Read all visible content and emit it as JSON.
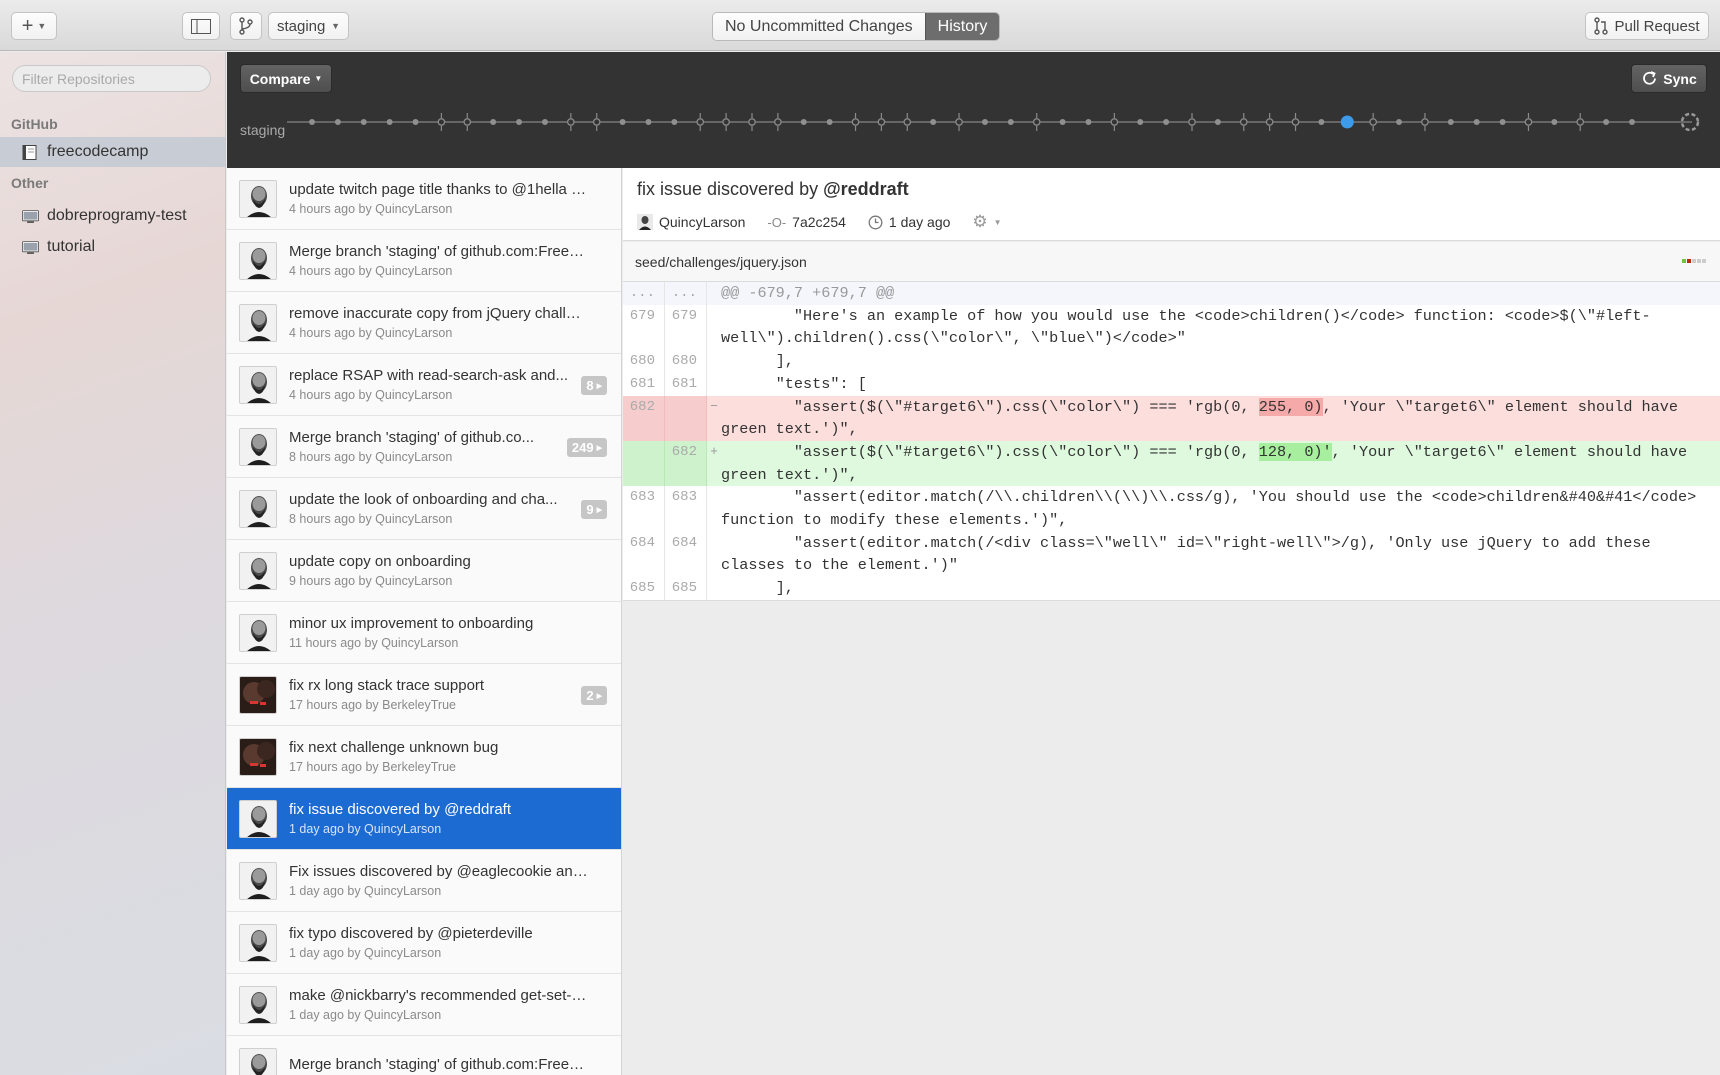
{
  "toolbar": {
    "add_icon": "plus-icon",
    "branch_name": "staging",
    "segments": [
      "No Uncommitted Changes",
      "History"
    ],
    "active_segment": "History",
    "pull_request_label": "Pull Request"
  },
  "sidebar": {
    "filter_placeholder": "Filter Repositories",
    "github_header": "GitHub",
    "github_repos": [
      "freecodecamp"
    ],
    "other_header": "Other",
    "other_repos": [
      "dobreprogramy-test",
      "tutorial"
    ]
  },
  "timeline": {
    "compare_label": "Compare",
    "sync_label": "Sync",
    "branch_label": "staging",
    "accent": "#3d9be9"
  },
  "commits": [
    {
      "title": "update twitch page title thanks to @1hella for...",
      "meta": "4 hours ago by QuincyLarson",
      "author": "QuincyLarson",
      "badge": ""
    },
    {
      "title": "Merge branch 'staging' of github.com:FreeCo...",
      "meta": "4 hours ago by QuincyLarson",
      "author": "QuincyLarson",
      "badge": ""
    },
    {
      "title": "remove inaccurate copy from jQuery challenge",
      "meta": "4 hours ago by QuincyLarson",
      "author": "QuincyLarson",
      "badge": ""
    },
    {
      "title": "replace RSAP with read-search-ask and...",
      "meta": "4 hours ago by QuincyLarson",
      "author": "QuincyLarson",
      "badge": "8"
    },
    {
      "title": "Merge branch 'staging' of github.co...",
      "meta": "8 hours ago by QuincyLarson",
      "author": "QuincyLarson",
      "badge": "249"
    },
    {
      "title": "update the look of onboarding and cha...",
      "meta": "8 hours ago by QuincyLarson",
      "author": "QuincyLarson",
      "badge": "9"
    },
    {
      "title": "update copy on onboarding",
      "meta": "9 hours ago by QuincyLarson",
      "author": "QuincyLarson",
      "badge": ""
    },
    {
      "title": "minor ux improvement to onboarding",
      "meta": "11 hours ago by QuincyLarson",
      "author": "QuincyLarson",
      "badge": ""
    },
    {
      "title": "fix rx long stack trace support",
      "meta": "17 hours ago by BerkeleyTrue",
      "author": "BerkeleyTrue",
      "badge": "2"
    },
    {
      "title": "fix next challenge unknown bug",
      "meta": "17 hours ago by BerkeleyTrue",
      "author": "BerkeleyTrue",
      "badge": ""
    },
    {
      "title": "fix issue discovered by @reddraft",
      "meta": "1 day ago by QuincyLarson",
      "author": "QuincyLarson",
      "badge": "",
      "selected": true
    },
    {
      "title": "Fix issues discovered by @eaglecookie and @...",
      "meta": "1 day ago by QuincyLarson",
      "author": "QuincyLarson",
      "badge": ""
    },
    {
      "title": "fix typo discovered by @pieterdeville",
      "meta": "1 day ago by QuincyLarson",
      "author": "QuincyLarson",
      "badge": ""
    },
    {
      "title": "make @nickbarry's recommended get-set-for...",
      "meta": "1 day ago by QuincyLarson",
      "author": "QuincyLarson",
      "badge": ""
    },
    {
      "title": "Merge branch 'staging' of github.com:FreeCo...",
      "meta": "",
      "author": "QuincyLarson",
      "badge": ""
    }
  ],
  "detail": {
    "title_prefix": "fix issue discovered by ",
    "title_mention": "@reddraft",
    "author": "QuincyLarson",
    "sha": "7a2c254",
    "time": "1 day ago",
    "file": "seed/challenges/jquery.json",
    "diff": [
      {
        "type": "hunk",
        "old": "...",
        "new": "...",
        "mark": "",
        "code": "@@ -679,7 +679,7 @@"
      },
      {
        "type": "ctx",
        "old": "679",
        "new": "679",
        "mark": "",
        "code": "        \"Here's an example of how you would use the <code>children()</code> function: <code>$(\\\"#left-well\\\").children().css(\\\"color\\\", \\\"blue\\\")</code>\""
      },
      {
        "type": "ctx",
        "old": "680",
        "new": "680",
        "mark": "",
        "code": "      ],"
      },
      {
        "type": "ctx",
        "old": "681",
        "new": "681",
        "mark": "",
        "code": "      \"tests\": ["
      },
      {
        "type": "del",
        "old": "682",
        "new": "",
        "mark": "−",
        "pre": "        \"assert($(\\\"#target6\\\").css(\\\"color\\\") === 'rgb(0, ",
        "hl": "255, 0)",
        "post": ", 'Your \\\"target6\\\" element should have green text.')\","
      },
      {
        "type": "add",
        "old": "",
        "new": "682",
        "mark": "+",
        "pre": "        \"assert($(\\\"#target6\\\").css(\\\"color\\\") === 'rgb(0, ",
        "hl": "128, 0)'",
        "post": ", 'Your \\\"target6\\\" element should have green text.')\","
      },
      {
        "type": "ctx",
        "old": "683",
        "new": "683",
        "mark": "",
        "code": "        \"assert(editor.match(/\\\\.children\\\\(\\\\)\\\\.css/g), 'You should use the <code>children&#40&#41</code> function to modify these elements.')\","
      },
      {
        "type": "ctx",
        "old": "684",
        "new": "684",
        "mark": "",
        "code": "        \"assert(editor.match(/<div class=\\\"well\\\" id=\\\"right-well\\\">/g), 'Only use jQuery to add these classes to the element.')\""
      },
      {
        "type": "ctx",
        "old": "685",
        "new": "685",
        "mark": "",
        "code": "      ],"
      }
    ]
  }
}
